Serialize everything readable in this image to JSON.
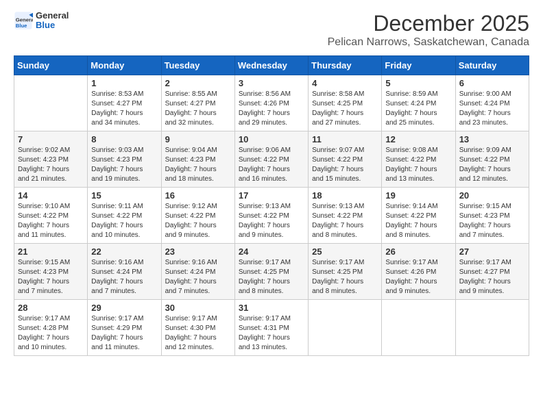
{
  "logo": {
    "general": "General",
    "blue": "Blue"
  },
  "title": "December 2025",
  "subtitle": "Pelican Narrows, Saskatchewan, Canada",
  "days_of_week": [
    "Sunday",
    "Monday",
    "Tuesday",
    "Wednesday",
    "Thursday",
    "Friday",
    "Saturday"
  ],
  "weeks": [
    [
      {
        "day": "",
        "info": ""
      },
      {
        "day": "1",
        "info": "Sunrise: 8:53 AM\nSunset: 4:27 PM\nDaylight: 7 hours\nand 34 minutes."
      },
      {
        "day": "2",
        "info": "Sunrise: 8:55 AM\nSunset: 4:27 PM\nDaylight: 7 hours\nand 32 minutes."
      },
      {
        "day": "3",
        "info": "Sunrise: 8:56 AM\nSunset: 4:26 PM\nDaylight: 7 hours\nand 29 minutes."
      },
      {
        "day": "4",
        "info": "Sunrise: 8:58 AM\nSunset: 4:25 PM\nDaylight: 7 hours\nand 27 minutes."
      },
      {
        "day": "5",
        "info": "Sunrise: 8:59 AM\nSunset: 4:24 PM\nDaylight: 7 hours\nand 25 minutes."
      },
      {
        "day": "6",
        "info": "Sunrise: 9:00 AM\nSunset: 4:24 PM\nDaylight: 7 hours\nand 23 minutes."
      }
    ],
    [
      {
        "day": "7",
        "info": "Sunrise: 9:02 AM\nSunset: 4:23 PM\nDaylight: 7 hours\nand 21 minutes."
      },
      {
        "day": "8",
        "info": "Sunrise: 9:03 AM\nSunset: 4:23 PM\nDaylight: 7 hours\nand 19 minutes."
      },
      {
        "day": "9",
        "info": "Sunrise: 9:04 AM\nSunset: 4:23 PM\nDaylight: 7 hours\nand 18 minutes."
      },
      {
        "day": "10",
        "info": "Sunrise: 9:06 AM\nSunset: 4:22 PM\nDaylight: 7 hours\nand 16 minutes."
      },
      {
        "day": "11",
        "info": "Sunrise: 9:07 AM\nSunset: 4:22 PM\nDaylight: 7 hours\nand 15 minutes."
      },
      {
        "day": "12",
        "info": "Sunrise: 9:08 AM\nSunset: 4:22 PM\nDaylight: 7 hours\nand 13 minutes."
      },
      {
        "day": "13",
        "info": "Sunrise: 9:09 AM\nSunset: 4:22 PM\nDaylight: 7 hours\nand 12 minutes."
      }
    ],
    [
      {
        "day": "14",
        "info": "Sunrise: 9:10 AM\nSunset: 4:22 PM\nDaylight: 7 hours\nand 11 minutes."
      },
      {
        "day": "15",
        "info": "Sunrise: 9:11 AM\nSunset: 4:22 PM\nDaylight: 7 hours\nand 10 minutes."
      },
      {
        "day": "16",
        "info": "Sunrise: 9:12 AM\nSunset: 4:22 PM\nDaylight: 7 hours\nand 9 minutes."
      },
      {
        "day": "17",
        "info": "Sunrise: 9:13 AM\nSunset: 4:22 PM\nDaylight: 7 hours\nand 9 minutes."
      },
      {
        "day": "18",
        "info": "Sunrise: 9:13 AM\nSunset: 4:22 PM\nDaylight: 7 hours\nand 8 minutes."
      },
      {
        "day": "19",
        "info": "Sunrise: 9:14 AM\nSunset: 4:22 PM\nDaylight: 7 hours\nand 8 minutes."
      },
      {
        "day": "20",
        "info": "Sunrise: 9:15 AM\nSunset: 4:23 PM\nDaylight: 7 hours\nand 7 minutes."
      }
    ],
    [
      {
        "day": "21",
        "info": "Sunrise: 9:15 AM\nSunset: 4:23 PM\nDaylight: 7 hours\nand 7 minutes."
      },
      {
        "day": "22",
        "info": "Sunrise: 9:16 AM\nSunset: 4:24 PM\nDaylight: 7 hours\nand 7 minutes."
      },
      {
        "day": "23",
        "info": "Sunrise: 9:16 AM\nSunset: 4:24 PM\nDaylight: 7 hours\nand 7 minutes."
      },
      {
        "day": "24",
        "info": "Sunrise: 9:17 AM\nSunset: 4:25 PM\nDaylight: 7 hours\nand 8 minutes."
      },
      {
        "day": "25",
        "info": "Sunrise: 9:17 AM\nSunset: 4:25 PM\nDaylight: 7 hours\nand 8 minutes."
      },
      {
        "day": "26",
        "info": "Sunrise: 9:17 AM\nSunset: 4:26 PM\nDaylight: 7 hours\nand 9 minutes."
      },
      {
        "day": "27",
        "info": "Sunrise: 9:17 AM\nSunset: 4:27 PM\nDaylight: 7 hours\nand 9 minutes."
      }
    ],
    [
      {
        "day": "28",
        "info": "Sunrise: 9:17 AM\nSunset: 4:28 PM\nDaylight: 7 hours\nand 10 minutes."
      },
      {
        "day": "29",
        "info": "Sunrise: 9:17 AM\nSunset: 4:29 PM\nDaylight: 7 hours\nand 11 minutes."
      },
      {
        "day": "30",
        "info": "Sunrise: 9:17 AM\nSunset: 4:30 PM\nDaylight: 7 hours\nand 12 minutes."
      },
      {
        "day": "31",
        "info": "Sunrise: 9:17 AM\nSunset: 4:31 PM\nDaylight: 7 hours\nand 13 minutes."
      },
      {
        "day": "",
        "info": ""
      },
      {
        "day": "",
        "info": ""
      },
      {
        "day": "",
        "info": ""
      }
    ]
  ]
}
